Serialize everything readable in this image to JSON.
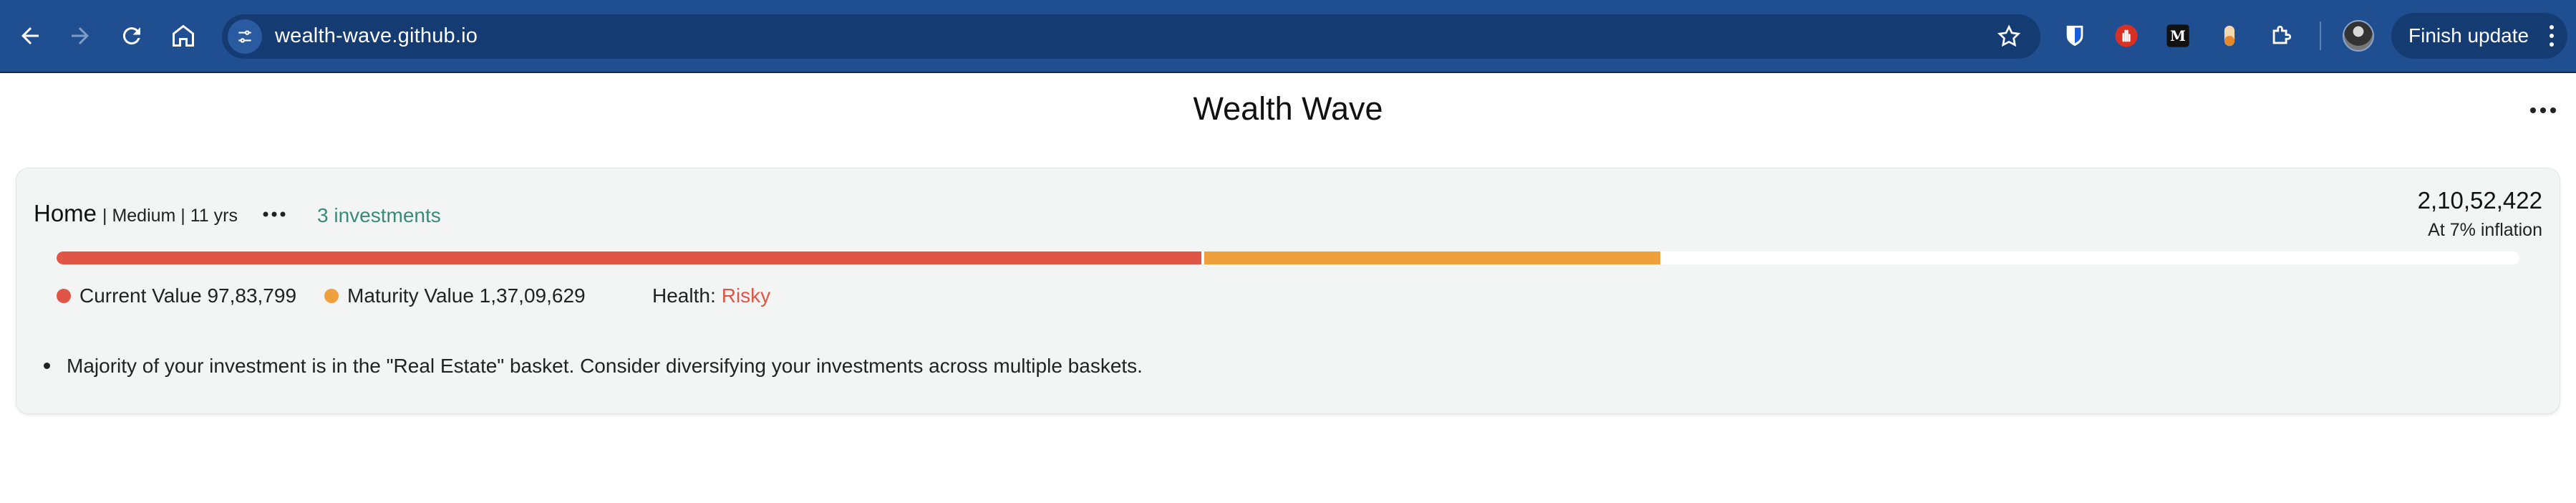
{
  "browser": {
    "url": "wealth-wave.github.io",
    "finish_update_label": "Finish update",
    "extensions": [
      "bitwarden-icon",
      "stop-hand-icon",
      "medium-icon",
      "pill-icon",
      "puzzle-extensions-icon"
    ]
  },
  "page": {
    "title": "Wealth Wave"
  },
  "goal": {
    "name": "Home",
    "meta": "| Medium | 11 yrs",
    "investments_link": "3 investments",
    "target_amount": "2,10,52,422",
    "inflation_note": "At 7% inflation",
    "progress": {
      "current_fraction": 0.4648,
      "maturity_fraction": 0.6512
    },
    "legend": {
      "current_label": "Current Value 97,83,799",
      "maturity_label": "Maturity Value 1,37,09,629",
      "health_label": "Health:",
      "health_value": "Risky"
    },
    "insights": [
      "Majority of your investment is in the \"Real Estate\" basket. Consider diversifying your investments across multiple baskets."
    ]
  },
  "colors": {
    "toolbar": "#1f4e91",
    "current": "#e05545",
    "maturity": "#efa03d",
    "link": "#3a8a76",
    "risky": "#e05545"
  }
}
